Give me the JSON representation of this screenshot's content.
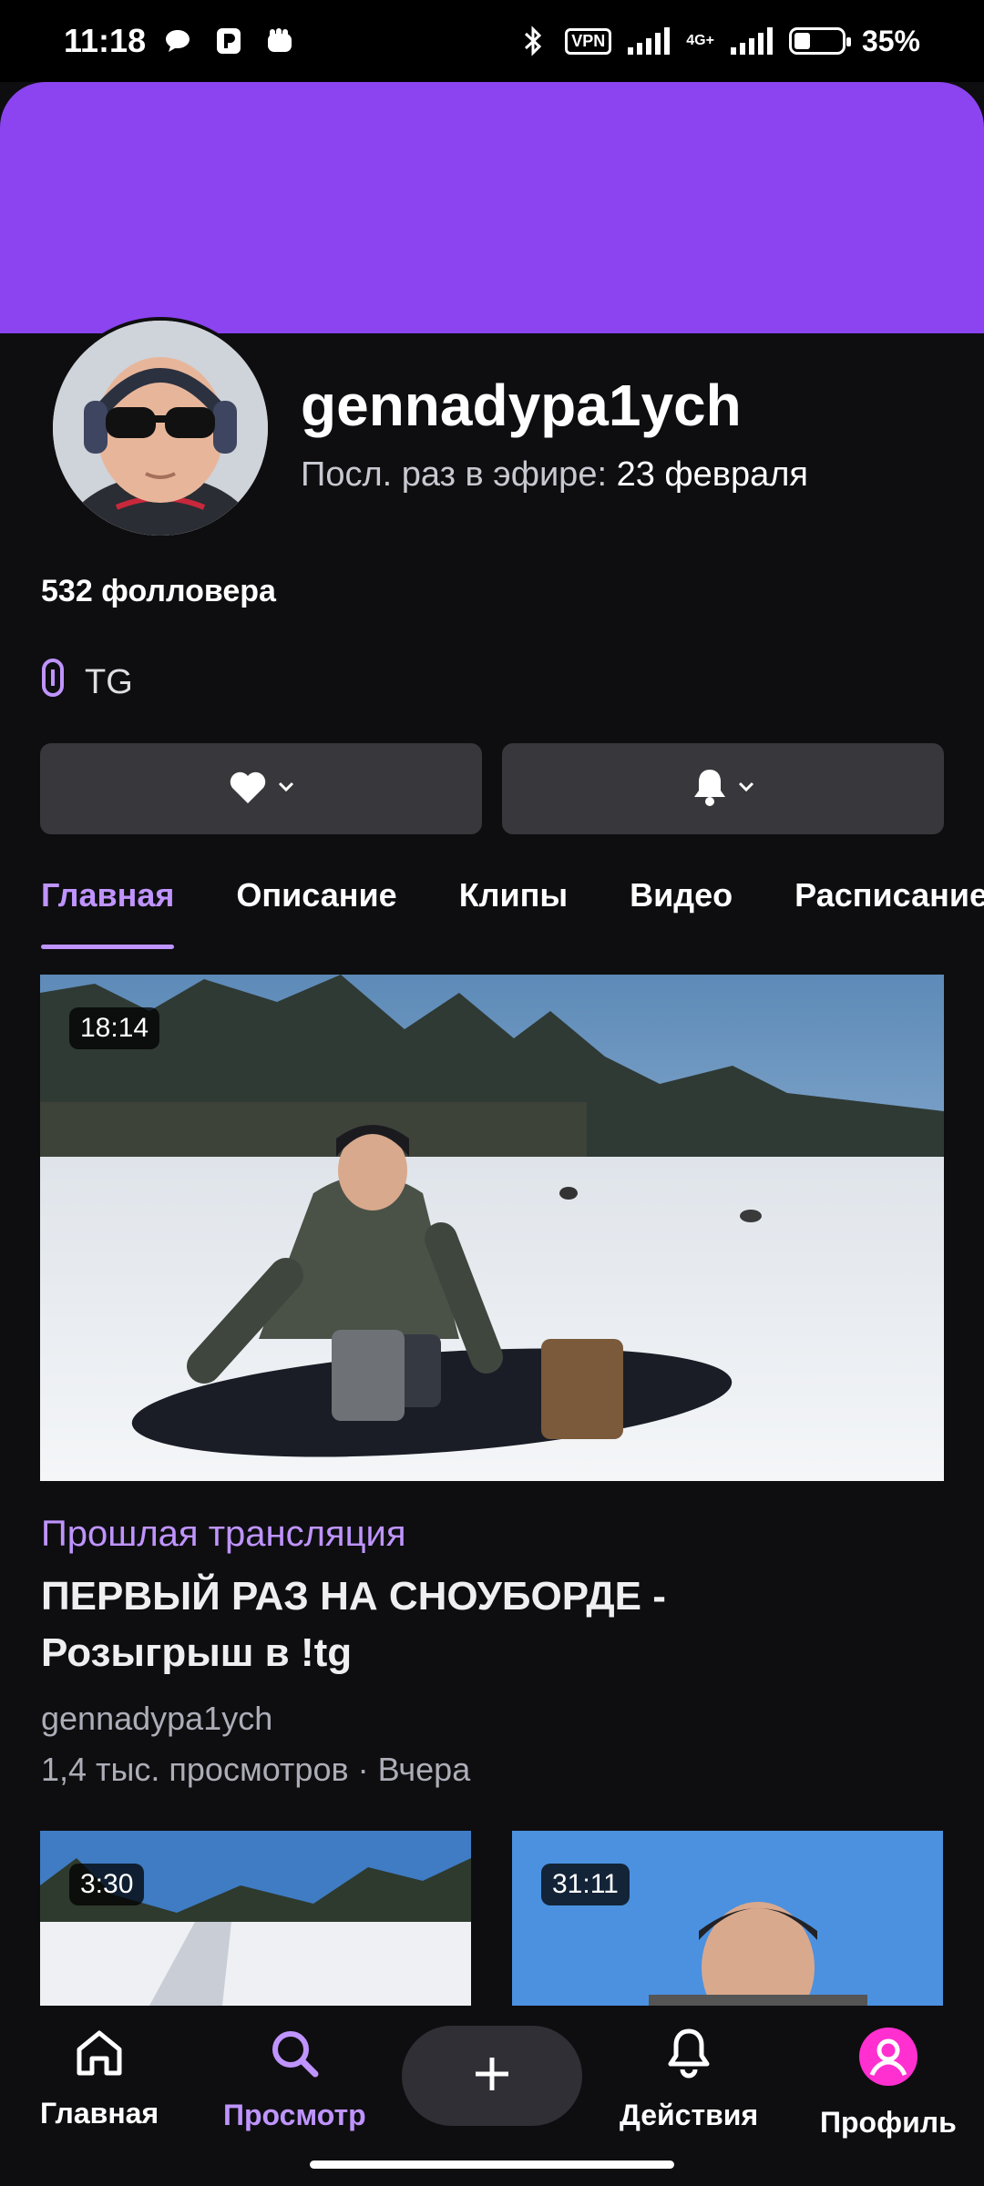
{
  "status_bar": {
    "time": "11:18",
    "vpn_label": "VPN",
    "network": "4G+",
    "battery": "35%"
  },
  "channel": {
    "username": "gennadypa1ych",
    "last_live_label": "Посл. раз в эфире:",
    "last_live_date": "23 февраля",
    "followers": "532 фолловера",
    "link_label": "TG"
  },
  "tabs": [
    "Главная",
    "Описание",
    "Клипы",
    "Видео",
    "Расписание"
  ],
  "featured": {
    "duration": "18:14",
    "category": "Прошлая трансляция",
    "title": "ПЕРВЫЙ РАЗ НА СНОУБОРДЕ - Розыгрыш в !tg",
    "channel": "gennadypa1ych",
    "meta": "1,4 тыс. просмотров · Вчера"
  },
  "more_videos": [
    {
      "duration": "3:30"
    },
    {
      "duration": "31:11"
    }
  ],
  "bottom_nav": {
    "home": "Главная",
    "browse": "Просмотр",
    "activity": "Действия",
    "profile": "Профиль"
  },
  "colors": {
    "accent": "#bf94ff",
    "banner": "#8b44ef",
    "background": "#0e0e10",
    "button": "#37373c"
  }
}
